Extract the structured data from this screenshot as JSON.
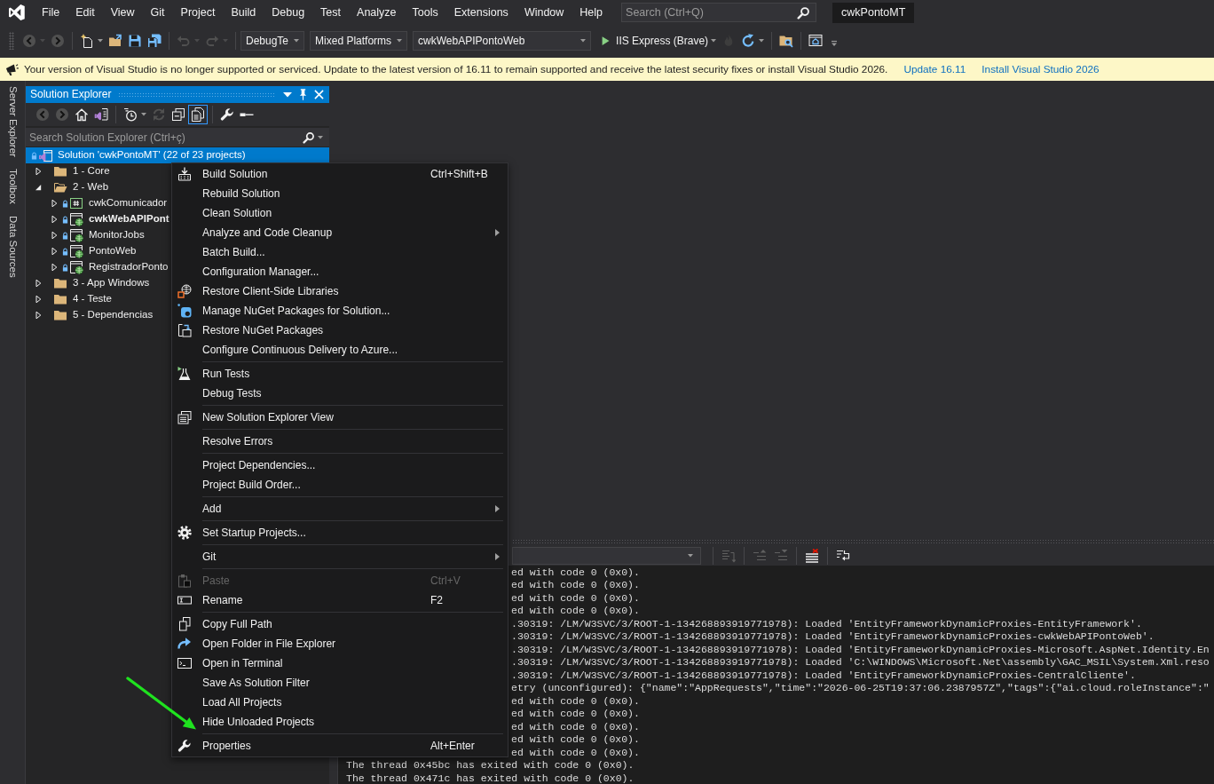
{
  "menu_bar": {
    "items": [
      "File",
      "Edit",
      "View",
      "Git",
      "Project",
      "Build",
      "Debug",
      "Test",
      "Analyze",
      "Tools",
      "Extensions",
      "Window",
      "Help"
    ],
    "search": {
      "placeholder": "Search (Ctrl+Q)"
    },
    "title": "cwkPontoMT"
  },
  "toolbar": {
    "items": [
      {
        "kind": "back",
        "disabled": true
      },
      {
        "kind": "forward",
        "disabled": true
      },
      {
        "kind": "separator"
      },
      {
        "kind": "new-project",
        "disabled": false
      },
      {
        "kind": "open",
        "disabled": false
      },
      {
        "kind": "save",
        "disabled": false
      },
      {
        "kind": "save-all",
        "disabled": false
      },
      {
        "kind": "separator"
      },
      {
        "kind": "undo",
        "disabled": true
      },
      {
        "kind": "redo",
        "disabled": true
      },
      {
        "kind": "separator"
      },
      {
        "kind": "combo",
        "value": "DebugTe"
      },
      {
        "kind": "combo",
        "value": "Mixed Platforms"
      },
      {
        "kind": "combo",
        "value": "cwkWebAPIPontoWeb"
      },
      {
        "kind": "run",
        "label": "IIS Express (Brave)",
        "disabled": false
      },
      {
        "kind": "hot-reload",
        "disabled": true
      },
      {
        "kind": "refresh",
        "disabled": false
      },
      {
        "kind": "separator"
      },
      {
        "kind": "find-folder",
        "disabled": false
      },
      {
        "kind": "separator"
      },
      {
        "kind": "browser-link",
        "disabled": false
      }
    ]
  },
  "info_bar": {
    "message": "Your version of Visual Studio is no longer supported or serviced. Update to the latest version of 16.11 to remain supported and receive the latest security fixes or install Visual Studio 2026.",
    "links": [
      "Update 16.11",
      "Install Visual Studio 2026"
    ]
  },
  "side_tabs": [
    "Server Explorer",
    "Toolbox",
    "Data Sources"
  ],
  "solution_explorer": {
    "title": "Solution Explorer",
    "toolbar": [
      {
        "kind": "back",
        "disabled": true,
        "selected": false
      },
      {
        "kind": "forward",
        "disabled": true,
        "selected": false
      },
      {
        "kind": "home",
        "disabled": false,
        "selected": false
      },
      {
        "kind": "switch-views",
        "disabled": false,
        "selected": false
      },
      {
        "kind": "separator"
      },
      {
        "kind": "pending-changes",
        "disabled": false,
        "selected": false
      },
      {
        "kind": "sync",
        "disabled": true,
        "selected": false
      },
      {
        "kind": "collapse-all",
        "disabled": false,
        "selected": false
      },
      {
        "kind": "show-all-files",
        "disabled": false,
        "selected": true
      },
      {
        "kind": "separator"
      },
      {
        "kind": "properties",
        "disabled": false,
        "selected": false
      },
      {
        "kind": "preview",
        "disabled": false,
        "selected": false
      }
    ],
    "search": {
      "placeholder": "Search Solution Explorer (Ctrl+ç)"
    },
    "tree": [
      {
        "kind": "solution",
        "label": "Solution 'cwkPontoMT' (22 of 23 projects)",
        "locked": true,
        "selected": true,
        "children": [
          {
            "kind": "folder",
            "label": "1 - Core",
            "locked": false,
            "selected": false,
            "expanded": false
          },
          {
            "kind": "folder",
            "label": "2 - Web",
            "locked": false,
            "selected": false,
            "expanded": true,
            "children": [
              {
                "kind": "csharp-project",
                "label": "cwkComunicador",
                "locked": true,
                "selected": false,
                "expanded": false,
                "startup": false
              },
              {
                "kind": "web-project",
                "label": "cwkWebAPIPont",
                "locked": true,
                "selected": false,
                "expanded": false,
                "startup": true
              },
              {
                "kind": "web-project",
                "label": "MonitorJobs",
                "locked": true,
                "selected": false,
                "expanded": false,
                "startup": false
              },
              {
                "kind": "web-project",
                "label": "PontoWeb",
                "locked": true,
                "selected": false,
                "expanded": false,
                "startup": false
              },
              {
                "kind": "web-project",
                "label": "RegistradorPonto",
                "locked": true,
                "selected": false,
                "expanded": false,
                "startup": false
              }
            ]
          },
          {
            "kind": "folder",
            "label": "3 - App Windows",
            "locked": false,
            "selected": false,
            "expanded": false
          },
          {
            "kind": "folder",
            "label": "4 - Teste",
            "locked": false,
            "selected": false,
            "expanded": false
          },
          {
            "kind": "folder",
            "label": "5 - Dependencias",
            "locked": false,
            "selected": false,
            "expanded": false
          }
        ]
      }
    ]
  },
  "context_menu": {
    "groups": [
      [
        {
          "label": "Build Solution",
          "shortcut": "Ctrl+Shift+B",
          "submenu": false,
          "disabled": false,
          "pointed_at": false
        },
        {
          "label": "Rebuild Solution",
          "submenu": false,
          "disabled": false,
          "pointed_at": false
        },
        {
          "label": "Clean Solution",
          "submenu": false,
          "disabled": false,
          "pointed_at": false
        },
        {
          "label": "Analyze and Code Cleanup",
          "submenu": true,
          "disabled": false,
          "pointed_at": false
        },
        {
          "label": "Batch Build...",
          "submenu": false,
          "disabled": false,
          "pointed_at": false
        },
        {
          "label": "Configuration Manager...",
          "submenu": false,
          "disabled": false,
          "pointed_at": false
        },
        {
          "label": "Restore Client-Side Libraries",
          "submenu": false,
          "disabled": false,
          "pointed_at": false
        },
        {
          "label": "Manage NuGet Packages for Solution...",
          "submenu": false,
          "disabled": false,
          "pointed_at": false
        },
        {
          "label": "Restore NuGet Packages",
          "submenu": false,
          "disabled": false,
          "pointed_at": false
        },
        {
          "label": "Configure Continuous Delivery to Azure...",
          "submenu": false,
          "disabled": false,
          "pointed_at": false
        }
      ],
      [
        {
          "label": "Run Tests",
          "submenu": false,
          "disabled": false,
          "pointed_at": false
        },
        {
          "label": "Debug Tests",
          "submenu": false,
          "disabled": false,
          "pointed_at": false
        }
      ],
      [
        {
          "label": "New Solution Explorer View",
          "submenu": false,
          "disabled": false,
          "pointed_at": false
        }
      ],
      [
        {
          "label": "Resolve Errors",
          "submenu": false,
          "disabled": false,
          "pointed_at": false
        }
      ],
      [
        {
          "label": "Project Dependencies...",
          "submenu": false,
          "disabled": false,
          "pointed_at": false
        },
        {
          "label": "Project Build Order...",
          "submenu": false,
          "disabled": false,
          "pointed_at": false
        }
      ],
      [
        {
          "label": "Add",
          "submenu": true,
          "disabled": false,
          "pointed_at": false
        }
      ],
      [
        {
          "label": "Set Startup Projects...",
          "submenu": false,
          "disabled": false,
          "pointed_at": false
        }
      ],
      [
        {
          "label": "Git",
          "submenu": true,
          "disabled": false,
          "pointed_at": false
        }
      ],
      [
        {
          "label": "Paste",
          "shortcut": "Ctrl+V",
          "submenu": false,
          "disabled": true,
          "pointed_at": false
        },
        {
          "label": "Rename",
          "shortcut": "F2",
          "submenu": false,
          "disabled": false,
          "pointed_at": false
        }
      ],
      [
        {
          "label": "Copy Full Path",
          "submenu": false,
          "disabled": false,
          "pointed_at": false
        },
        {
          "label": "Open Folder in File Explorer",
          "submenu": false,
          "disabled": false,
          "pointed_at": false
        },
        {
          "label": "Open in Terminal",
          "submenu": false,
          "disabled": false,
          "pointed_at": false
        },
        {
          "label": "Save As Solution Filter",
          "submenu": false,
          "disabled": false,
          "pointed_at": false
        },
        {
          "label": "Load All Projects",
          "submenu": false,
          "disabled": false,
          "pointed_at": false
        },
        {
          "label": "Hide Unloaded Projects",
          "submenu": false,
          "disabled": false,
          "pointed_at": true
        }
      ],
      [
        {
          "label": "Properties",
          "shortcut": "Alt+Enter",
          "submenu": false,
          "disabled": false,
          "pointed_at": false
        }
      ]
    ]
  },
  "output": {
    "toolbar": [
      {
        "kind": "combo"
      },
      {
        "kind": "separator"
      },
      {
        "kind": "find-in-code",
        "disabled": true
      },
      {
        "kind": "separator"
      },
      {
        "kind": "previous",
        "disabled": true
      },
      {
        "kind": "next",
        "disabled": true
      },
      {
        "kind": "separator"
      },
      {
        "kind": "clear",
        "disabled": false
      },
      {
        "kind": "separator"
      },
      {
        "kind": "word-wrap",
        "disabled": false
      }
    ],
    "lines": [
      {
        "kind": "covered",
        "text": "ed with code 0 (0x0)."
      },
      {
        "kind": "covered",
        "text": "ed with code 0 (0x0)."
      },
      {
        "kind": "covered",
        "text": "ed with code 0 (0x0)."
      },
      {
        "kind": "covered",
        "text": "ed with code 0 (0x0)."
      },
      {
        "kind": "covered",
        "text": ".30319: /LM/W3SVC/3/ROOT-1-134268893919771978): Loaded 'EntityFrameworkDynamicProxies-EntityFramework'."
      },
      {
        "kind": "covered",
        "text": ".30319: /LM/W3SVC/3/ROOT-1-134268893919771978): Loaded 'EntityFrameworkDynamicProxies-cwkWebAPIPontoWeb'."
      },
      {
        "kind": "covered",
        "text": ".30319: /LM/W3SVC/3/ROOT-1-134268893919771978): Loaded 'EntityFrameworkDynamicProxies-Microsoft.AspNet.Identity.En"
      },
      {
        "kind": "covered",
        "text": ".30319: /LM/W3SVC/3/ROOT-1-134268893919771978): Loaded 'C:\\WINDOWS\\Microsoft.Net\\assembly\\GAC_MSIL\\System.Xml.reso"
      },
      {
        "kind": "covered",
        "text": ".30319: /LM/W3SVC/3/ROOT-1-134268893919771978): Loaded 'EntityFrameworkDynamicProxies-CentralCliente'."
      },
      {
        "kind": "covered",
        "text": "etry (unconfigured): {\"name\":\"AppRequests\",\"time\":\"2026-06-25T19:37:06.2387957Z\",\"tags\":{\"ai.cloud.roleInstance\":\""
      },
      {
        "kind": "covered",
        "text": "ed with code 0 (0x0)."
      },
      {
        "kind": "covered",
        "text": "ed with code 0 (0x0)."
      },
      {
        "kind": "covered",
        "text": "ed with code 0 (0x0)."
      },
      {
        "kind": "covered",
        "text": "ed with code 0 (0x0)."
      },
      {
        "kind": "covered",
        "text": "ed with code 0 (0x0)."
      },
      {
        "kind": "full",
        "text": "The thread 0x45bc has exited with code 0 (0x0)."
      },
      {
        "kind": "full",
        "text": "The thread 0x471c has exited with code 0 (0x0)."
      }
    ]
  }
}
